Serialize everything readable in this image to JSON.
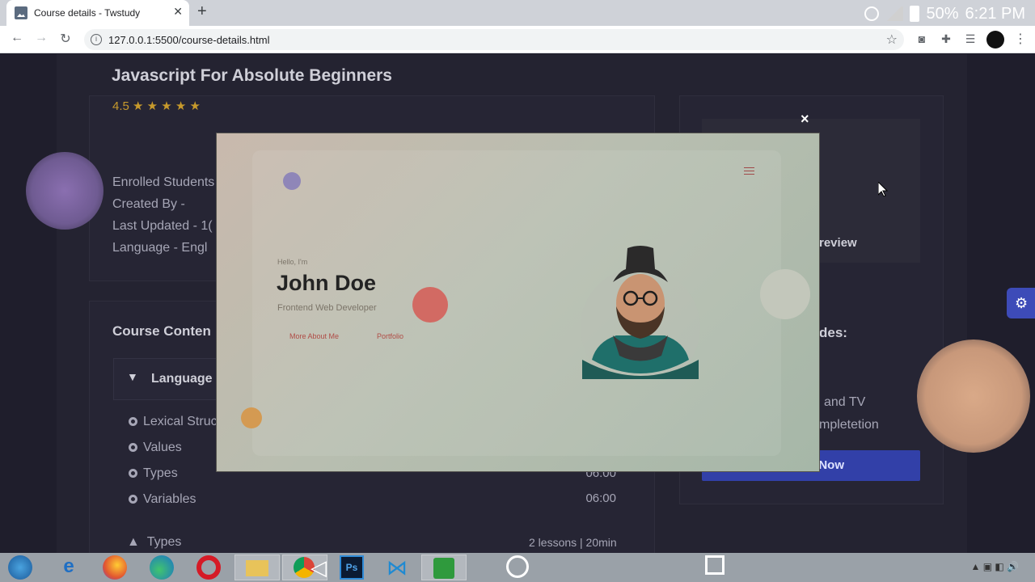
{
  "browser": {
    "tab_title": "Course details - Twstudy",
    "url": "127.0.0.1:5500/course-details.html",
    "battery_percent": "50%",
    "time": "6:21 PM"
  },
  "course": {
    "title": "Javascript For Absolute Beginners",
    "rating": "4.5",
    "stars": 5,
    "enrolled_label": "Enrolled Students",
    "created_by_label": "Created By -",
    "last_updated_label": "Last Updated -",
    "last_updated_value": "1(",
    "language_label": "Language -",
    "language_value": "Engl"
  },
  "course_content": {
    "heading": "Course Conten",
    "section_label": "Language",
    "lessons": [
      {
        "name": "Lexical Struc",
        "time": ""
      },
      {
        "name": "Values",
        "time": ""
      },
      {
        "name": "Types",
        "time": "06:00"
      },
      {
        "name": "Variables",
        "time": "06:00"
      }
    ],
    "next_section": "Types",
    "next_section_meta": "2 lessons | 20min"
  },
  "sidebar": {
    "preview_label": "review",
    "includes_heading": "des:",
    "include_1": "and TV",
    "include_2": "mpletetion",
    "enroll_label": "Now"
  },
  "modal": {
    "close_label": "×",
    "hello": "Hello, I'm",
    "name": "John Doe",
    "role": "Frontend Web Developer",
    "btn_about": "More About Me",
    "btn_portfolio": "Portfolio"
  },
  "colors": {
    "accent": "#3240a8",
    "star": "#c79a2c",
    "modal_bg_start": "#c9b9ad",
    "modal_bg_end": "#a6b7a8"
  }
}
